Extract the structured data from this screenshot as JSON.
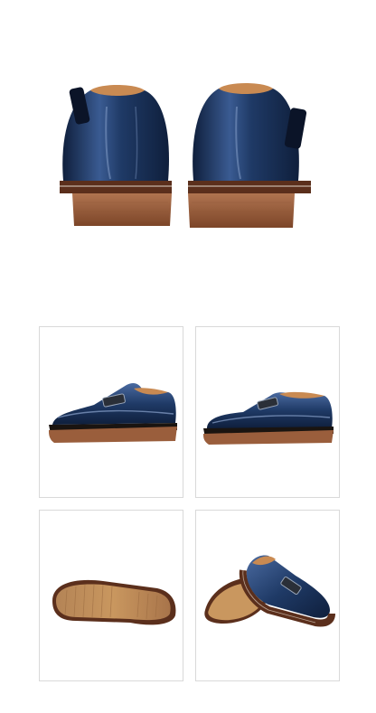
{
  "page": {
    "background": "#ffffff",
    "tile_border": "#d9d9d9"
  },
  "product": {
    "upper_color": "#1f3a66",
    "upper_shade": "#0f1f3c",
    "upper_highlight": "#7c96c2",
    "sole_color": "#9a5e3c",
    "sole_dark": "#6e3a22",
    "lining_color": "#c98a52",
    "buckle_color": "#2a2f38"
  },
  "views": [
    {
      "name": "rear-view"
    },
    {
      "name": "side-view-left"
    },
    {
      "name": "side-view-right"
    },
    {
      "name": "sole-view"
    },
    {
      "name": "angled-view"
    }
  ]
}
